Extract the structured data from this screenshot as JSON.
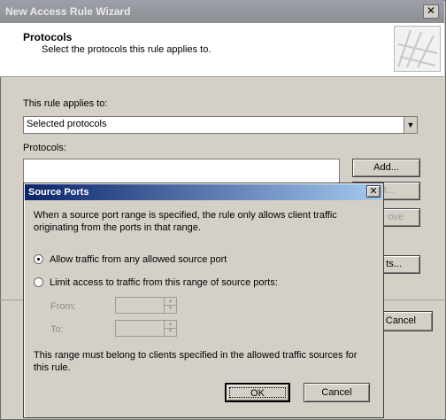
{
  "wizard": {
    "title": "New Access Rule Wizard",
    "close_glyph": "✕",
    "header_title": "Protocols",
    "header_subtitle": "Select the protocols this rule applies to.",
    "applies_label": "This rule applies to:",
    "applies_value": "Selected protocols",
    "protocols_label": "Protocols:",
    "add_label": "Add...",
    "edit_partial": "it...",
    "remove_partial": "ove",
    "ports_partial": "ts...",
    "cancel_label": "Cancel"
  },
  "dialog": {
    "title": "Source Ports",
    "close_glyph": "✕",
    "description_line1": "When a source port range is specified, the rule only allows client traffic",
    "description_line2": "originating from the ports in that range.",
    "radio_any": "Allow traffic from any allowed source port",
    "radio_limit": "Limit access to traffic from this range of source ports:",
    "from_label": "From:",
    "to_label": "To:",
    "note_line1": "This range must belong to clients specified in the allowed traffic sources for",
    "note_line2": "this rule.",
    "ok_label": "OK",
    "cancel_label": "Cancel"
  }
}
